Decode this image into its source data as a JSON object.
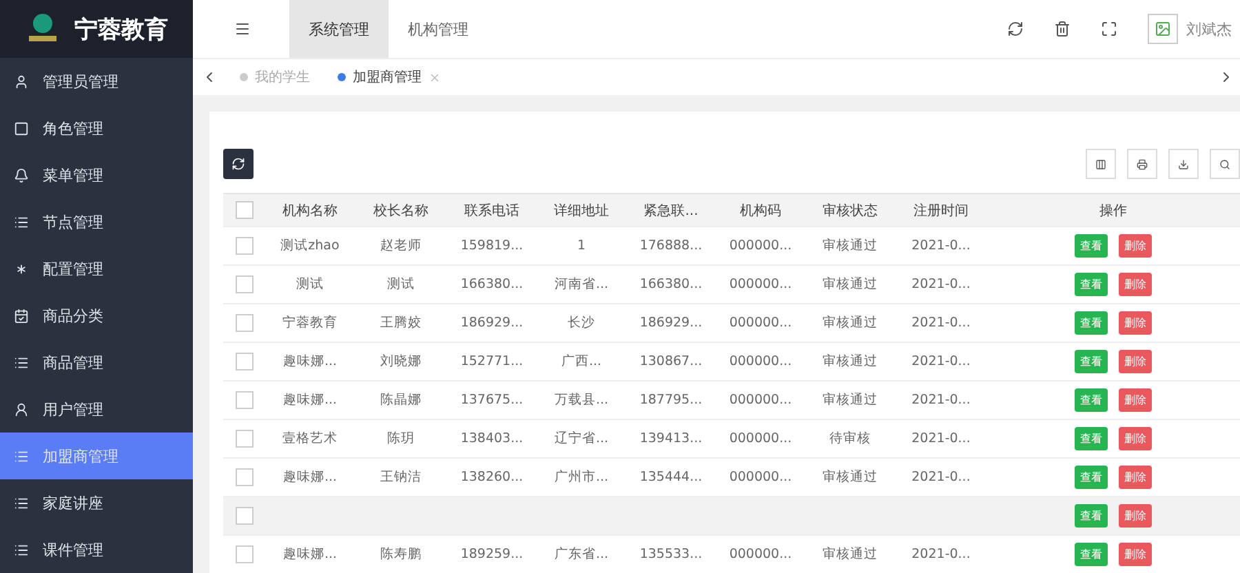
{
  "brand": {
    "name": "宁蓉教育"
  },
  "sidebar": {
    "items": [
      {
        "label": "管理员管理",
        "selected": false
      },
      {
        "label": "角色管理",
        "selected": false
      },
      {
        "label": "菜单管理",
        "selected": false
      },
      {
        "label": "节点管理",
        "selected": false
      },
      {
        "label": "配置管理",
        "selected": false
      },
      {
        "label": "商品分类",
        "selected": false
      },
      {
        "label": "商品管理",
        "selected": false
      },
      {
        "label": "用户管理",
        "selected": false
      },
      {
        "label": "加盟商管理",
        "selected": true
      },
      {
        "label": "家庭讲座",
        "selected": false
      },
      {
        "label": "课件管理",
        "selected": false
      }
    ]
  },
  "top_tabs": [
    {
      "label": "系统管理",
      "selected": true
    },
    {
      "label": "机构管理",
      "selected": false
    }
  ],
  "user": {
    "name": "刘斌杰"
  },
  "page_tabs": [
    {
      "label": "我的学生",
      "selected": false,
      "closable": false
    },
    {
      "label": "加盟商管理",
      "selected": true,
      "closable": true
    }
  ],
  "table": {
    "columns": [
      "机构名称",
      "校长名称",
      "联系电话",
      "详细地址",
      "紧急联...",
      "机构码",
      "审核状态",
      "注册时间",
      "操作"
    ],
    "all_checked": false,
    "rows": [
      {
        "cells": [
          "测试zhao",
          "赵老师",
          "159819...",
          "1",
          "176888...",
          "000000...",
          "审核通过",
          "2021-0..."
        ],
        "checked": false,
        "hovered": false,
        "actions": [
          {
            "kind": "view",
            "label": "查看"
          },
          {
            "kind": "delete",
            "label": "删除"
          }
        ]
      },
      {
        "cells": [
          "测试",
          "测试",
          "166380...",
          "河南省...",
          "166380...",
          "000000...",
          "审核通过",
          "2021-0..."
        ],
        "checked": false,
        "hovered": false,
        "actions": [
          {
            "kind": "view",
            "label": "查看"
          },
          {
            "kind": "delete",
            "label": "删除"
          }
        ]
      },
      {
        "cells": [
          "宁蓉教育",
          "王腾姣",
          "186929...",
          "长沙",
          "186929...",
          "000000...",
          "审核通过",
          "2021-0..."
        ],
        "checked": false,
        "hovered": false,
        "actions": [
          {
            "kind": "view",
            "label": "查看"
          },
          {
            "kind": "delete",
            "label": "删除"
          }
        ]
      },
      {
        "cells": [
          "趣味娜...",
          "刘晓娜",
          "152771...",
          "广西...",
          "130867...",
          "000000...",
          "审核通过",
          "2021-0..."
        ],
        "checked": false,
        "hovered": false,
        "actions": [
          {
            "kind": "view",
            "label": "查看"
          },
          {
            "kind": "delete",
            "label": "删除"
          }
        ]
      },
      {
        "cells": [
          "趣味娜...",
          "陈晶娜",
          "137675...",
          "万载县...",
          "187795...",
          "000000...",
          "审核通过",
          "2021-0..."
        ],
        "checked": false,
        "hovered": false,
        "actions": [
          {
            "kind": "view",
            "label": "查看"
          },
          {
            "kind": "delete",
            "label": "删除"
          }
        ]
      },
      {
        "cells": [
          "壹格艺术",
          "陈玥",
          "138403...",
          "辽宁省...",
          "139413...",
          "000000...",
          "待审核",
          "2021-0..."
        ],
        "checked": false,
        "hovered": false,
        "actions": [
          {
            "kind": "view",
            "label": "查看"
          },
          {
            "kind": "delete",
            "label": "删除"
          }
        ]
      },
      {
        "cells": [
          "趣味娜...",
          "王钠洁",
          "138260...",
          "广州市...",
          "135444...",
          "000000...",
          "审核通过",
          "2021-0..."
        ],
        "checked": false,
        "hovered": false,
        "actions": [
          {
            "kind": "view",
            "label": "查看"
          },
          {
            "kind": "delete",
            "label": "删除"
          }
        ]
      },
      {
        "cells": [],
        "checked": false,
        "hovered": true,
        "actions": [
          {
            "kind": "view",
            "label": "查看"
          },
          {
            "kind": "delete",
            "label": "删除"
          }
        ]
      },
      {
        "cells": [
          "趣味娜...",
          "陈寿鹏",
          "189259...",
          "广东省...",
          "135533...",
          "000000...",
          "审核通过",
          "2021-0..."
        ],
        "checked": false,
        "hovered": false,
        "actions": [
          {
            "kind": "view",
            "label": "查看"
          },
          {
            "kind": "delete",
            "label": "删除"
          }
        ]
      }
    ]
  }
}
